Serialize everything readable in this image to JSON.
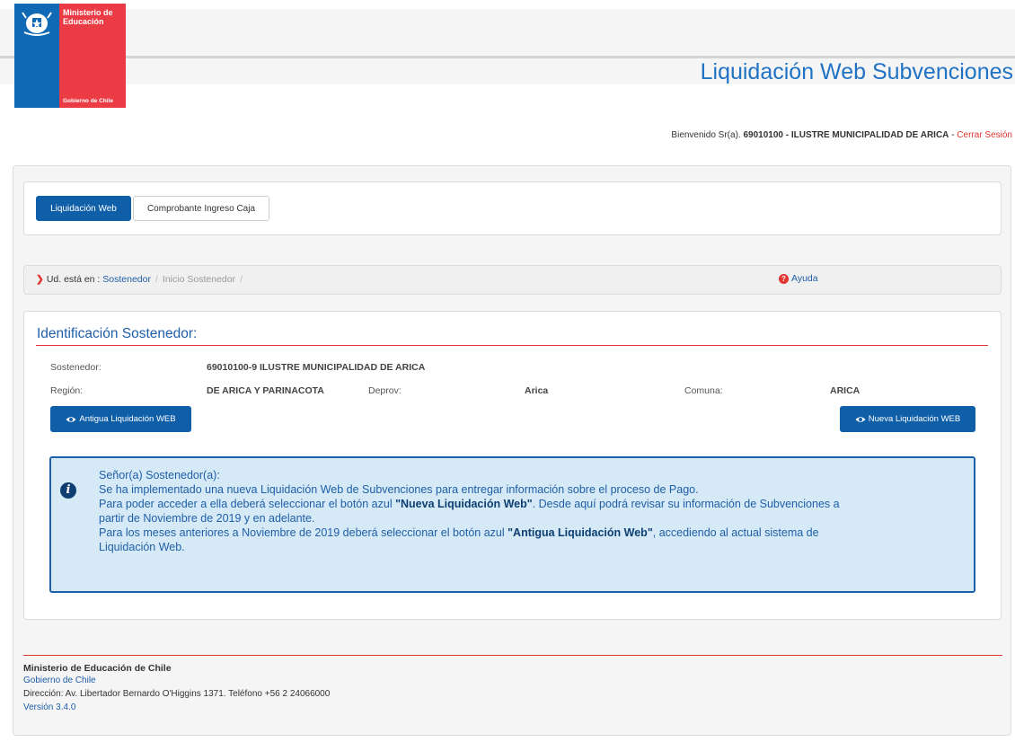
{
  "header": {
    "logo_line1": "Ministerio de Educación",
    "logo_line2": "Gobierno de Chile",
    "app_title": "Liquidación Web Subvenciones",
    "welcome_prefix": "Bienvenido Sr(a). ",
    "welcome_user": "69010100 - ILUSTRE MUNICIPALIDAD DE ARICA",
    "welcome_dash": " - ",
    "logout_label": "Cerrar Sesión"
  },
  "menu": {
    "tab_active": "Liquidación Web",
    "tab_inactive": "Comprobante Ingreso Caja"
  },
  "breadcrumb": {
    "prefix": "Ud. está en :",
    "item1": "Sostenedor",
    "sep": "/",
    "item2": "Inicio Sostenedor",
    "trail_sep": "/",
    "help_label": "Ayuda"
  },
  "section": {
    "title": "Identificación Sostenedor:",
    "sostenedor_label": "Sostenedor:",
    "sostenedor_value": "69010100-9 ILUSTRE MUNICIPALIDAD DE ARICA",
    "region_label": "Región:",
    "region_value": "DE ARICA Y PARINACOTA",
    "deprov_label": "Deprov:",
    "deprov_value": "Arica",
    "comuna_label": "Comuna:",
    "comuna_value": "ARICA",
    "old_button": "Antigua Liquidación WEB",
    "new_button": "Nueva Liquidación WEB"
  },
  "alert": {
    "l1": "Señor(a) Sostenedor(a):",
    "l2": "Se ha implementado una nueva Liquidación Web de Subvenciones para entregar información sobre el proceso de Pago.",
    "l3a": "Para poder acceder a ella deberá seleccionar el botón azul ",
    "l3b": "\"Nueva Liquidación Web\"",
    "l3c": ". Desde aquí podrá revisar su información de Subvenciones a",
    "l4": "partir de Noviembre de 2019 y en adelante.",
    "l5a": "Para los meses anteriores a Noviembre de 2019 deberá seleccionar el botón azul ",
    "l5b": "\"Antigua Liquidación Web\"",
    "l5c": ", accediendo al actual sistema de",
    "l6": "Liquidación Web."
  },
  "footer": {
    "org": "Ministerio de Educación de Chile",
    "gov_link": "Gobierno de Chile",
    "address": "Dirección: Av. Libertador Bernardo O'Higgins 1371. Teléfono +56 2 24066000",
    "version": "Versión 3.4.0"
  },
  "colors": {
    "brand_blue": "#0f5ea8",
    "brand_red": "#e0342f",
    "alert_bg": "#d5eaf6"
  }
}
